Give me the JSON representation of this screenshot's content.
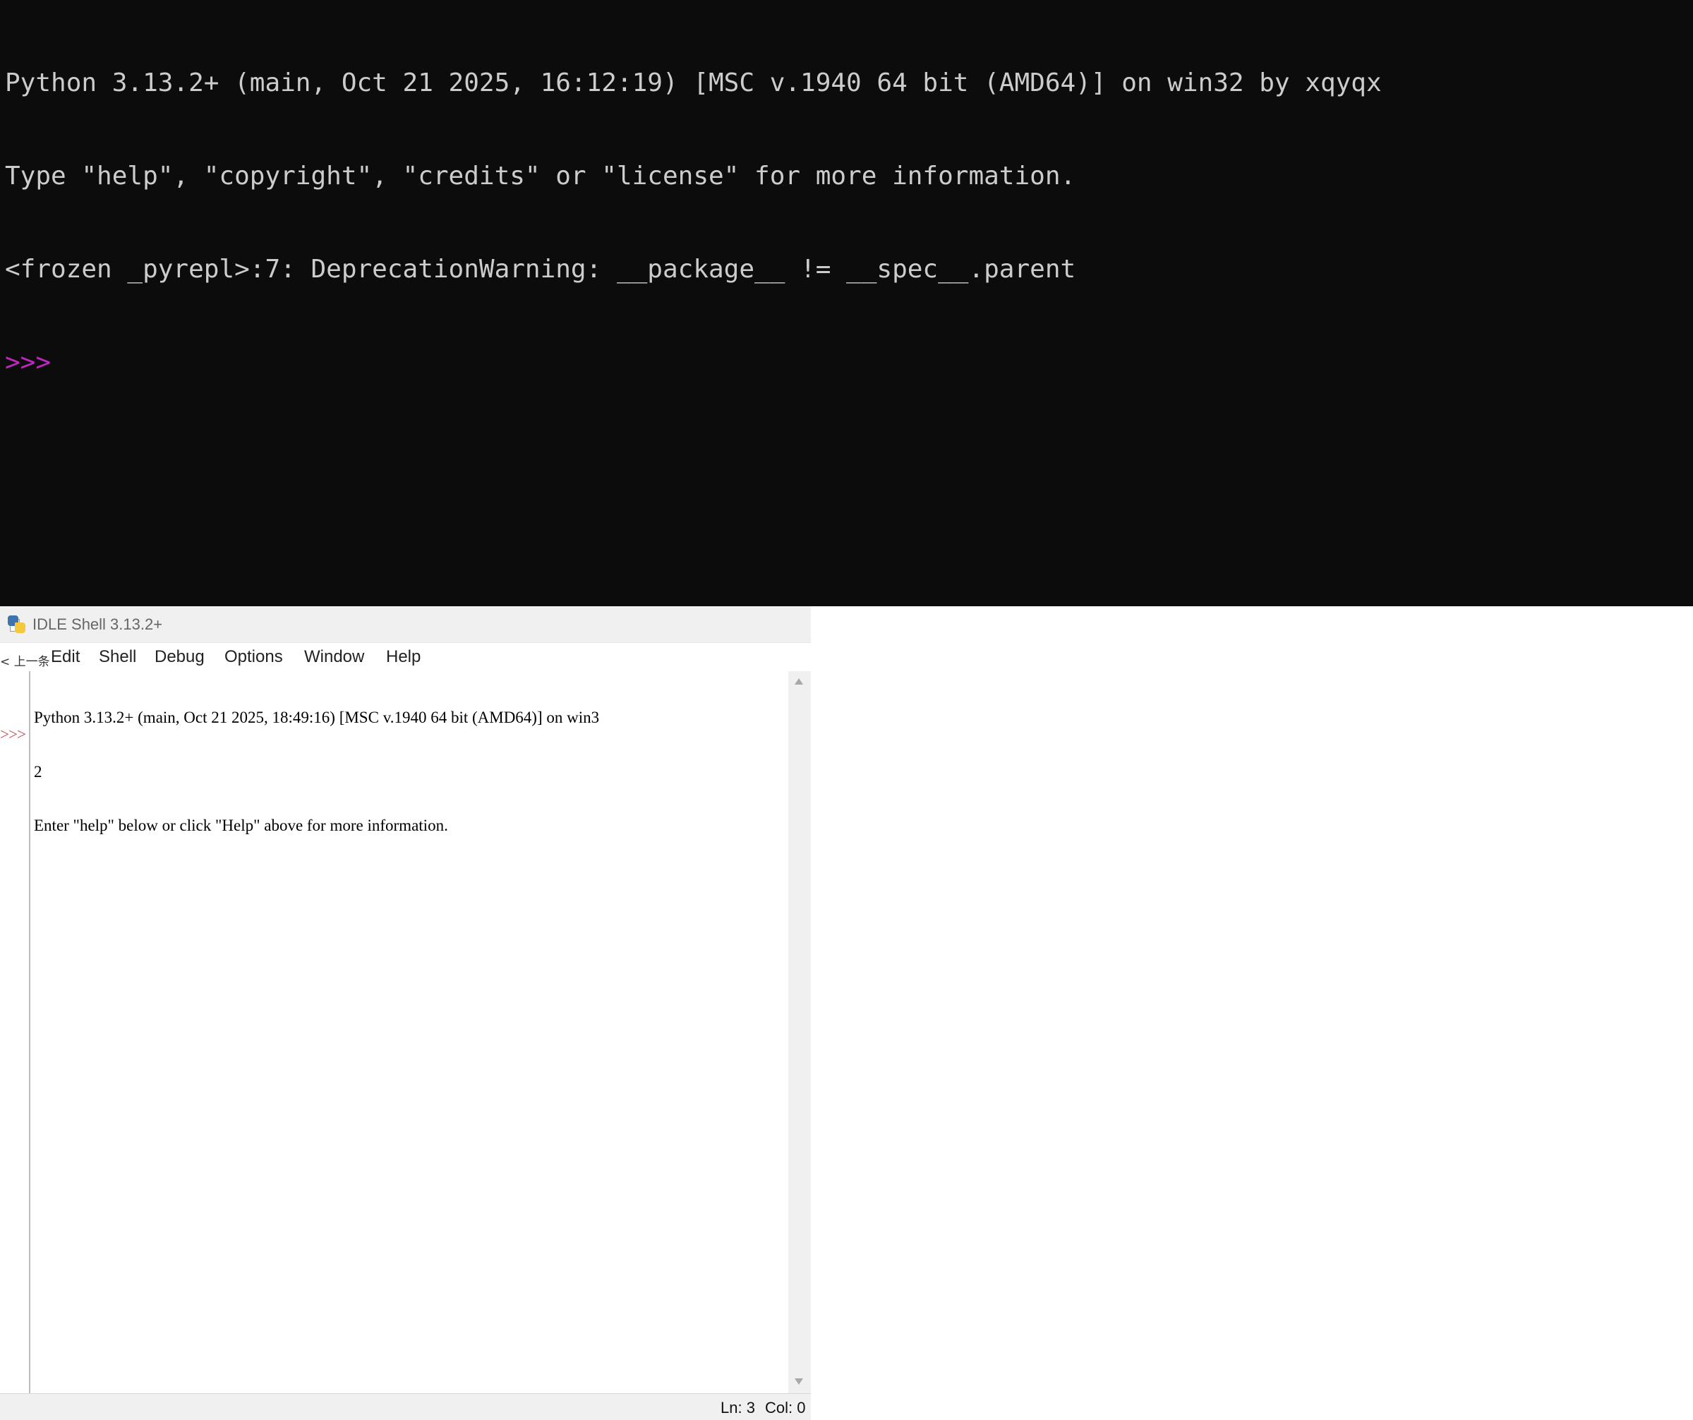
{
  "terminal": {
    "lines": [
      "Python 3.13.2+ (main, Oct 21 2025, 16:12:19) [MSC v.1940 64 bit (AMD64)] on win32 by xqyqx",
      "Type \"help\", \"copyright\", \"credits\" or \"license\" for more information.",
      "<frozen _pyrepl>:7: DeprecationWarning: __package__ != __spec__.parent"
    ],
    "prompt": ">>>",
    "background_color": "#0c0c0c",
    "text_color": "#cccccc",
    "prompt_color": "#c026c0"
  },
  "idle": {
    "title": "IDLE Shell 3.13.2+",
    "title_icon": "python-idle-icon",
    "back_link": "< 上一条",
    "menu": [
      "Edit",
      "Shell",
      "Debug",
      "Options",
      "Window",
      "Help"
    ],
    "shell_lines": [
      "Python 3.13.2+ (main, Oct 21 2025, 18:49:16) [MSC v.1940 64 bit (AMD64)] on win3",
      "2",
      "Enter \"help\" below or click \"Help\" above for more information."
    ],
    "prompt": ">>>",
    "prompt_color": "#c0504d",
    "status": {
      "ln": "Ln: 3",
      "col": "Col: 0"
    }
  }
}
